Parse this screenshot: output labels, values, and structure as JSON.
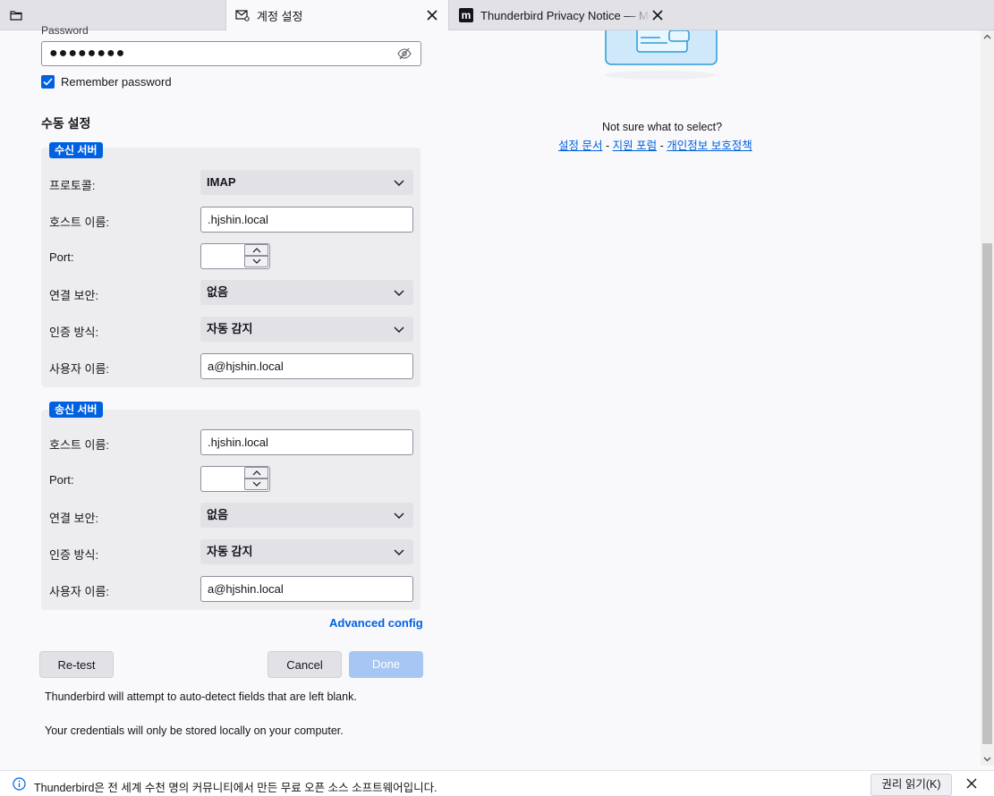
{
  "tabs": [
    {
      "label": "계정 설정",
      "active": true,
      "icon": "mail-gear-icon"
    },
    {
      "label": "Thunderbird Privacy Notice — Mo",
      "active": false,
      "icon": "mozilla-m-icon"
    }
  ],
  "password": {
    "label": "Password",
    "value": "●●●●●●●●"
  },
  "remember": {
    "label": "Remember password",
    "checked": true
  },
  "manual": {
    "title": "수동 설정"
  },
  "incoming": {
    "badge": "수신 서버",
    "protocol_label": "프로토콜:",
    "protocol_value": "IMAP",
    "hostname_label": "호스트 이름:",
    "hostname_value": ".hjshin.local",
    "port_label": "Port:",
    "port_value": "",
    "security_label": "연결 보안:",
    "security_value": "없음",
    "auth_label": "인증 방식:",
    "auth_value": "자동 감지",
    "username_label": "사용자 이름:",
    "username_value": "a@hjshin.local"
  },
  "outgoing": {
    "badge": "송신 서버",
    "hostname_label": "호스트 이름:",
    "hostname_value": ".hjshin.local",
    "port_label": "Port:",
    "port_value": "",
    "security_label": "연결 보안:",
    "security_value": "없음",
    "auth_label": "인증 방식:",
    "auth_value": "자동 감지",
    "username_label": "사용자 이름:",
    "username_value": "a@hjshin.local"
  },
  "advanced_label": "Advanced config",
  "buttons": {
    "retest": "Re-test",
    "cancel": "Cancel",
    "done": "Done"
  },
  "notes": {
    "autodetect": "Thunderbird will attempt to auto-detect fields that are left blank.",
    "credentials": "Your credentials will only be stored locally on your computer."
  },
  "help": {
    "question": "Not sure what to select?",
    "link_docs": "설정 문서",
    "link_forum": "지원 포럼",
    "link_privacy": "개인정보 보호정책",
    "separator": "-"
  },
  "notification": {
    "text": "Thunderbird은 전 세계 수천 명의 커뮤니티에서 만든 무료 오픈 소스 소프트웨어입니다.",
    "button": "권리 읽기(K)"
  },
  "colors": {
    "accent": "#0061e0",
    "done_disabled": "#a7c6f3"
  }
}
